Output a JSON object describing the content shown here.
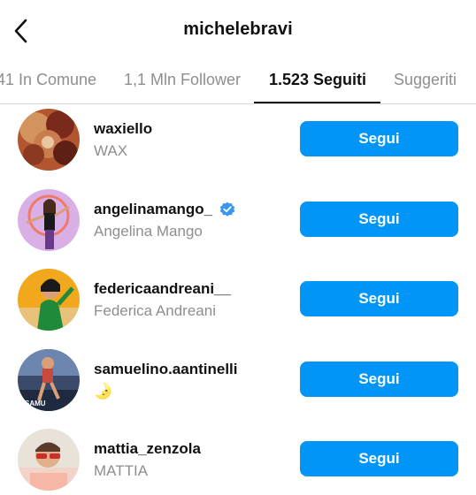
{
  "header": {
    "title": "michelebravi"
  },
  "tabs": [
    {
      "label": "41 In Comune"
    },
    {
      "label": "1,1 Mln Follower"
    },
    {
      "label": "1.523 Seguiti"
    },
    {
      "label": "Suggeriti"
    }
  ],
  "users": [
    {
      "username": "waxiello",
      "name": "WAX",
      "button": "Segui"
    },
    {
      "username": "angelinamango_",
      "name": "Angelina Mango",
      "button": "Segui",
      "verified": true
    },
    {
      "username": "federicaandreani__",
      "name": "Federica Andreani",
      "button": "Segui"
    },
    {
      "username": "samuelino.aantinelli",
      "name": "🌛",
      "button": "Segui",
      "avatar_text": "SAMU"
    },
    {
      "username": "mattia_zenzola",
      "name": "MATTIA",
      "button": "Segui"
    }
  ],
  "colors": {
    "button": "#0095f6",
    "secondary_text": "#8e8e8e",
    "verified": "#3897f0"
  }
}
